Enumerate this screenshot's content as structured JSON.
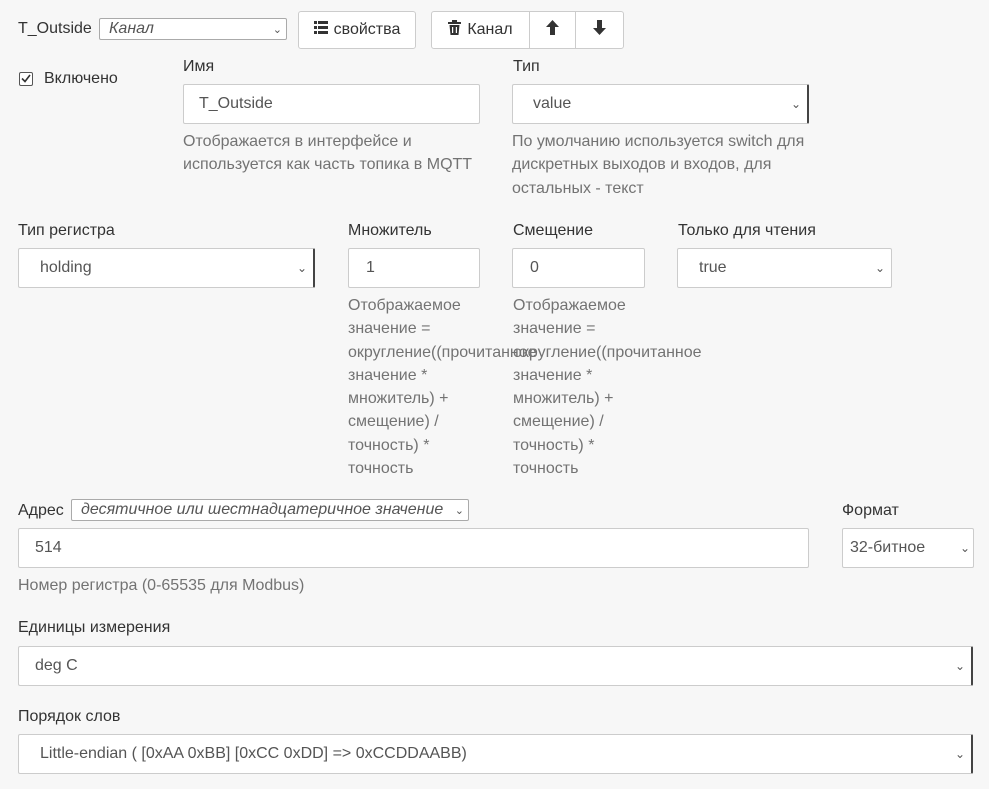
{
  "header": {
    "channel_name": "T_Outside",
    "channel_select": "Канал",
    "properties_button": "свойства",
    "delete_button": "Канал"
  },
  "enabled": {
    "label": "Включено",
    "checked": true
  },
  "name": {
    "label": "Имя",
    "value": "T_Outside",
    "help": "Отображается в интерфейсе и используется как часть топика в MQTT"
  },
  "type": {
    "label": "Тип",
    "value": "value",
    "help": "По умолчанию используется switch для дискретных выходов и входов, для остальных - текст"
  },
  "register_type": {
    "label": "Тип регистра",
    "value": "holding"
  },
  "multiplier": {
    "label": "Множитель",
    "value": "1",
    "help": "Отображаемое значение = округление((прочитанное значение * множитель) + смещение) / точность) * точность"
  },
  "offset": {
    "label": "Смещение",
    "value": "0",
    "help": "Отображаемое значение = округление((прочитанное значение * множитель) + смещение) / точность) * точность"
  },
  "read_only": {
    "label": "Только для чтения",
    "value": "true"
  },
  "address": {
    "label": "Адрес",
    "mode": "десятичное или шестнадцатеричное значение",
    "value": "514",
    "help": "Номер регистра (0-65535 для Modbus)"
  },
  "format": {
    "label": "Формат",
    "value": "32-битное"
  },
  "units": {
    "label": "Единицы измерения",
    "value": "deg C"
  },
  "word_order": {
    "label": "Порядок слов",
    "value": "Little-endian ( [0xAA 0xBB] [0xCC 0xDD] => 0xCCDDAABB)"
  }
}
